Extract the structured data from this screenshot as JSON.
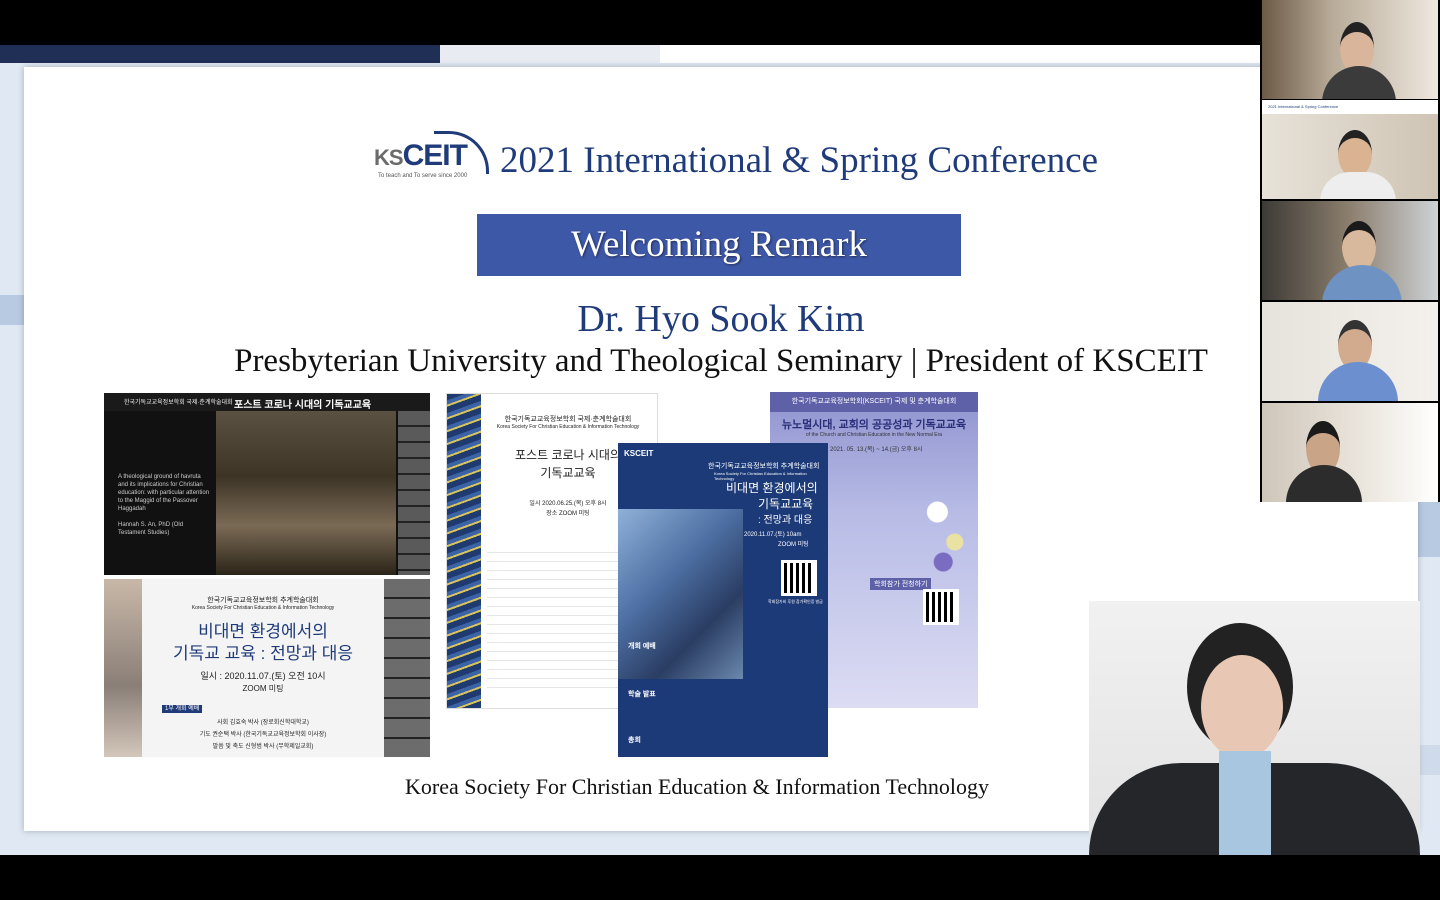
{
  "slide": {
    "logo": {
      "text": "KSCEIT",
      "prefix": "KS",
      "main": "CEIT",
      "tagline": "To teach and To serve since 2000"
    },
    "conference_title": "2021 International & Spring Conference",
    "banner": "Welcoming Remark",
    "speaker_name": "Dr. Hyo Sook Kim",
    "affiliation": "Presbyterian University and Theological Seminary | President of KSCEIT",
    "footer": "Korea Society For Christian Education & Information Technology",
    "thumbnails": {
      "t1": {
        "header": "한국기독교교육정보학회 국제·춘계학술대회",
        "title": "포스트 코로나 시대의 기독교교육",
        "body": "A theological ground of havruta and its implications for Christian education: with particular attention to the Maggid of the Passover Haggadah",
        "author": "Hannah S. An, PhD (Old Testament Studies)"
      },
      "t2": {
        "org": "한국기독교교육정보학회 추계학술대회",
        "org_en": "Korea Society For Christian Education & Information Technology",
        "title1": "비대면 환경에서의",
        "title2": "기독교 교육 : 전망과 대응",
        "date": "일시 : 2020.11.07.(토) 오전 10시",
        "place": "ZOOM 미팅",
        "session": "1부 개회 예배",
        "line1": "사회 김효숙 박사 (장로회신학대학교)",
        "line2": "기도 권순택 박사 (한국기독교교육정보학회 이사장)",
        "line3": "말씀 및 축도 신형범 박사 (무학제일교회)"
      },
      "t3": {
        "org": "한국기독교교육정보학회 국제·춘계학술대회",
        "org_en": "Korea Society For Christian Education & Information Technology",
        "title1": "포스트 코로나 시대의",
        "title2": "기독교교육",
        "date": "일시 2020.06.25.(목) 오후 8시",
        "place": "장소 ZOOM 미팅"
      },
      "t4": {
        "logo": "KSCEIT",
        "org": "한국기독교교육정보학회 추계학술대회",
        "org_en": "Korea Society For Christian Education & Information Technology",
        "title1": "비대면 환경에서의",
        "title2": "기독교교육",
        "title3": ": 전망과 대응",
        "date": "2020.11.07.(토) 10am",
        "place": "ZOOM 미팅",
        "qr_note": "학회참가비 후원 참가확인증 발급",
        "sec1": "개회 예배",
        "sec2": "학술 발표",
        "sec3": "총회"
      },
      "t5": {
        "header": "한국기독교교육정보학회(KSCEIT) 국제 및 춘계학술대회",
        "title": "뉴노멀시대, 교회의 공공성과 기독교교육",
        "subtitle": "of the Church and Christian Education in the New Normal Era",
        "date": "2021. 05. 13.(목) ~ 14.(금) 오후 8시",
        "apply": "학회참가 전청하기"
      }
    }
  },
  "participants": [
    {
      "name": "participant-1"
    },
    {
      "name": "participant-2",
      "slide_caption": "2021 International & Spring Conference"
    },
    {
      "name": "participant-3"
    },
    {
      "name": "participant-4"
    },
    {
      "name": "participant-5"
    }
  ],
  "colors": {
    "brand_navy": "#1f3b7a",
    "banner_blue": "#3e58a8",
    "background": "#dfe8f3"
  }
}
